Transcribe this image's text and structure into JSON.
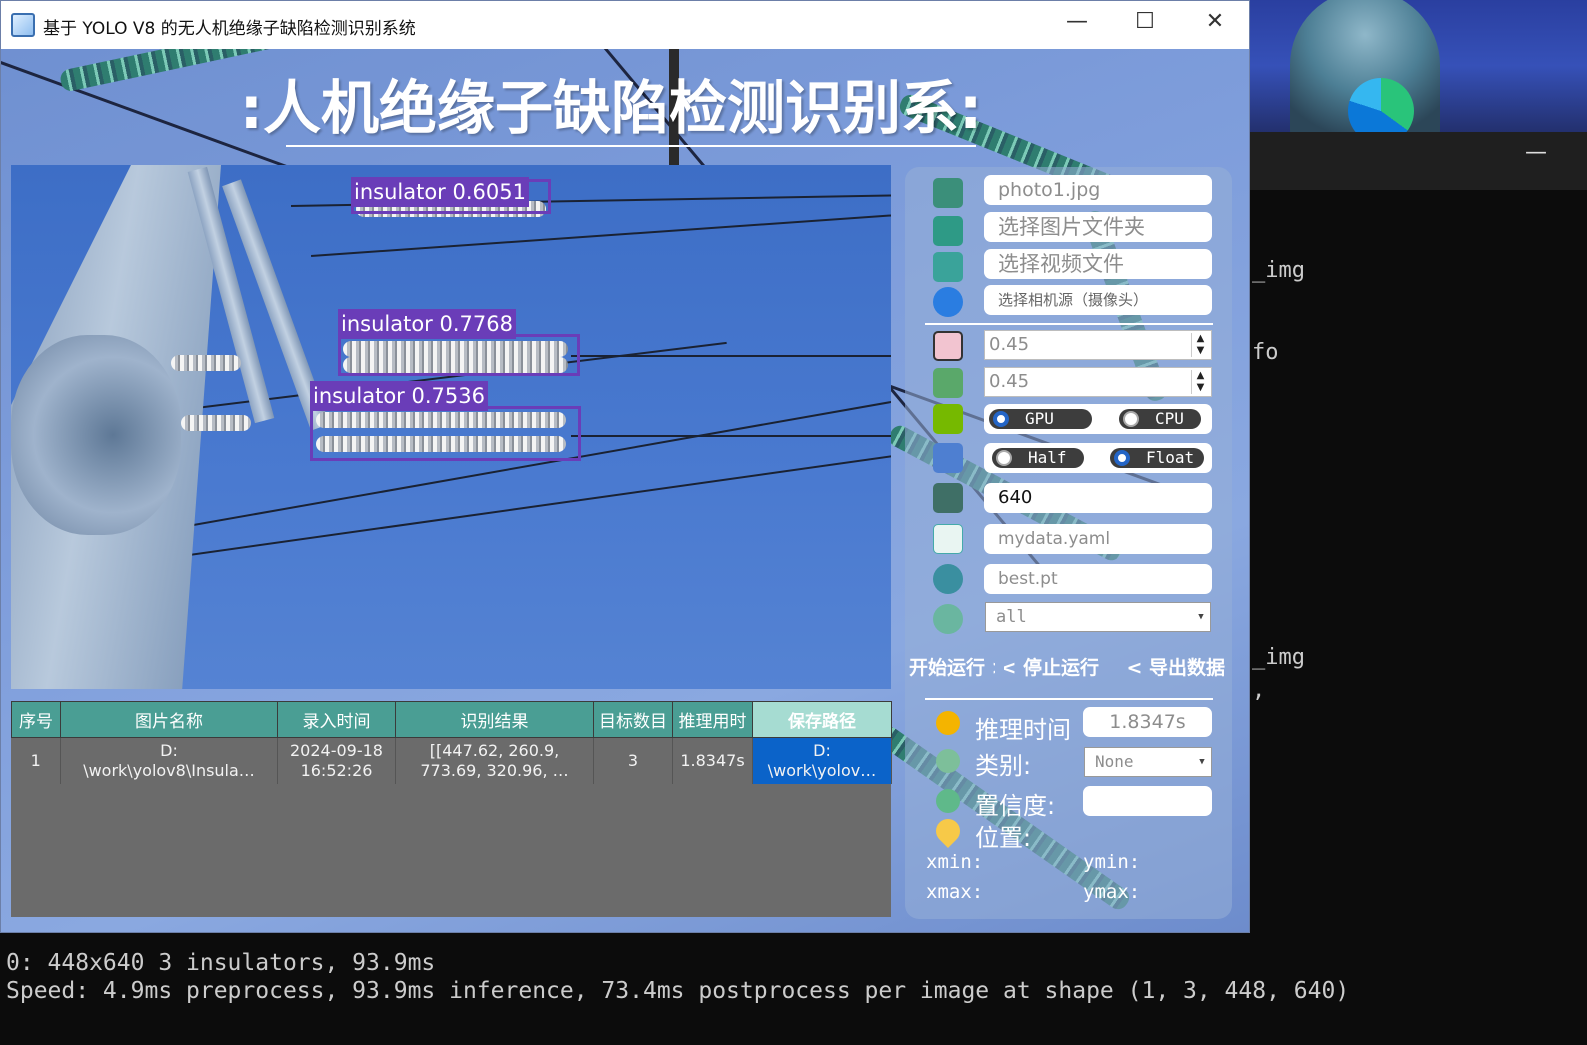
{
  "window": {
    "title": "基于 YOLO V8 的无人机绝缘子缺陷检测识别系统",
    "minimize_glyph": "—",
    "maximize_glyph": "☐",
    "close_glyph": "✕"
  },
  "header": {
    "title_visible": ":人机绝缘子缺陷检测识别系:"
  },
  "detections": [
    {
      "label": "insulator 0.6051"
    },
    {
      "label": "insulator 0.7768"
    },
    {
      "label": "insulator 0.7536"
    }
  ],
  "table": {
    "headers": [
      "序号",
      "图片名称",
      "录入时间",
      "识别结果",
      "目标数目",
      "推理用时",
      "保存路径"
    ],
    "rows": [
      {
        "index": "1",
        "name_line1": "D:",
        "name_line2": "\\work\\yolov8\\Insula…",
        "time_line1": "2024-09-18",
        "time_line2": "16:52:26",
        "result_line1": "[[447.62, 260.9,",
        "result_line2": "773.69, 320.96, …",
        "count": "3",
        "infer": "1.8347s",
        "path_line1": "D:",
        "path_line2": "\\work\\yolov…"
      }
    ]
  },
  "controls": {
    "image_file": "photo1.jpg",
    "image_folder": "选择图片文件夹",
    "video_file": "选择视频文件",
    "camera": "选择相机源（摄像头）",
    "conf": "0.45",
    "iou": "0.45",
    "device_gpu": "GPU",
    "device_cpu": "CPU",
    "device_selected": "GPU",
    "precision_half": "Half",
    "precision_float": "Float",
    "precision_selected": "Float",
    "imgsz": "640",
    "data_yaml": "mydata.yaml",
    "weights": "best.pt",
    "class_filter": "all",
    "btn_start": "开始运行 >",
    "btn_stop": "停止运行 >",
    "btn_export": "导出数据 >"
  },
  "info": {
    "infer_label": "推理时间",
    "infer_value": "1.8347s",
    "class_label": "类别:",
    "class_value": "None",
    "conf_label": "置信度:",
    "conf_value": "",
    "pos_label": "位置:",
    "xmin_label": "xmin:",
    "ymin_label": "ymin:",
    "xmax_label": "xmax:",
    "ymax_label": "ymax:"
  },
  "terminal": {
    "side_lines": [
      "_img",
      "fo",
      "_img",
      ","
    ],
    "line1": "0: 448x640 3 insulators, 93.9ms",
    "line2": "Speed: 4.9ms preprocess, 93.9ms inference, 73.4ms postprocess per image at shape (1, 3, 448, 640)",
    "minimize_glyph": "—"
  },
  "colors": {
    "bbox": "#6a3db8",
    "table_header": "#4a9e94",
    "selected_cell": "#0b63c9",
    "radio_selected": "#2465c6"
  }
}
